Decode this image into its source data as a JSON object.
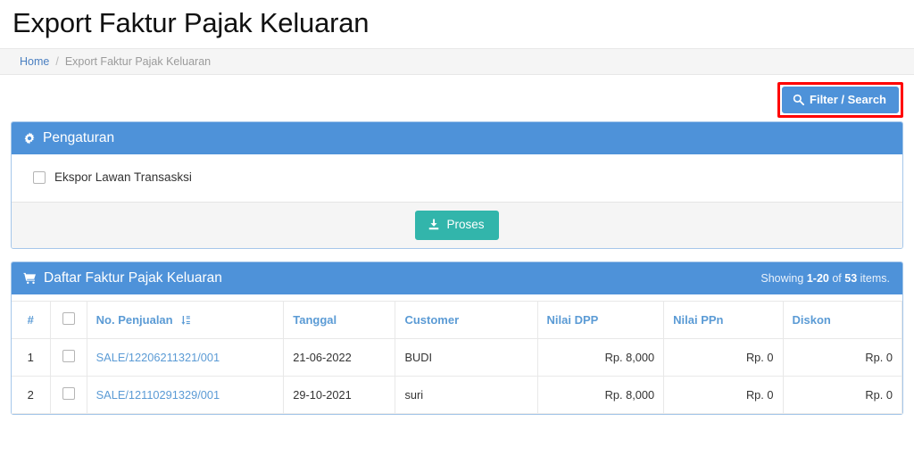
{
  "header": {
    "title": "Export Faktur Pajak Keluaran"
  },
  "breadcrumb": {
    "home": "Home",
    "separator": "/",
    "current": "Export Faktur Pajak Keluaran"
  },
  "toolbar": {
    "filter_label": "Filter / Search",
    "filter_icon": "search-icon",
    "highlight_color": "#ff0000",
    "button_color": "#4e92d9"
  },
  "settings_panel": {
    "title": "Pengaturan",
    "icon": "gear-icon",
    "checkbox_label": "Ekspor Lawan Transasksi",
    "checkbox_checked": false,
    "submit_label": "Proses",
    "submit_icon": "export-download-icon",
    "submit_color": "#32b5ab"
  },
  "list_panel": {
    "title": "Daftar Faktur Pajak Keluaran",
    "icon": "shopping-cart-icon",
    "showing_prefix": "Showing",
    "showing_range": "1-20",
    "showing_middle": "of",
    "showing_total": "53",
    "showing_suffix": "items."
  },
  "table": {
    "columns": [
      {
        "key": "num",
        "label": "#"
      },
      {
        "key": "check",
        "label": ""
      },
      {
        "key": "no_penjualan",
        "label": "No. Penjualan",
        "sort_icon": "sort-amount-down-icon"
      },
      {
        "key": "tanggal",
        "label": "Tanggal"
      },
      {
        "key": "customer",
        "label": "Customer"
      },
      {
        "key": "nilai_dpp",
        "label": "Nilai DPP"
      },
      {
        "key": "nilai_ppn",
        "label": "Nilai PPn"
      },
      {
        "key": "diskon",
        "label": "Diskon"
      }
    ],
    "select_all_checked": false,
    "rows": [
      {
        "num": "1",
        "checked": false,
        "no_penjualan": "SALE/12206211321/001",
        "tanggal": "21-06-2022",
        "customer": "BUDI",
        "nilai_dpp": "Rp. 8,000",
        "nilai_ppn": "Rp. 0",
        "diskon": "Rp. 0"
      },
      {
        "num": "2",
        "checked": false,
        "no_penjualan": "SALE/12110291329/001",
        "tanggal": "29-10-2021",
        "customer": "suri",
        "nilai_dpp": "Rp. 8,000",
        "nilai_ppn": "Rp. 0",
        "diskon": "Rp. 0"
      }
    ]
  }
}
